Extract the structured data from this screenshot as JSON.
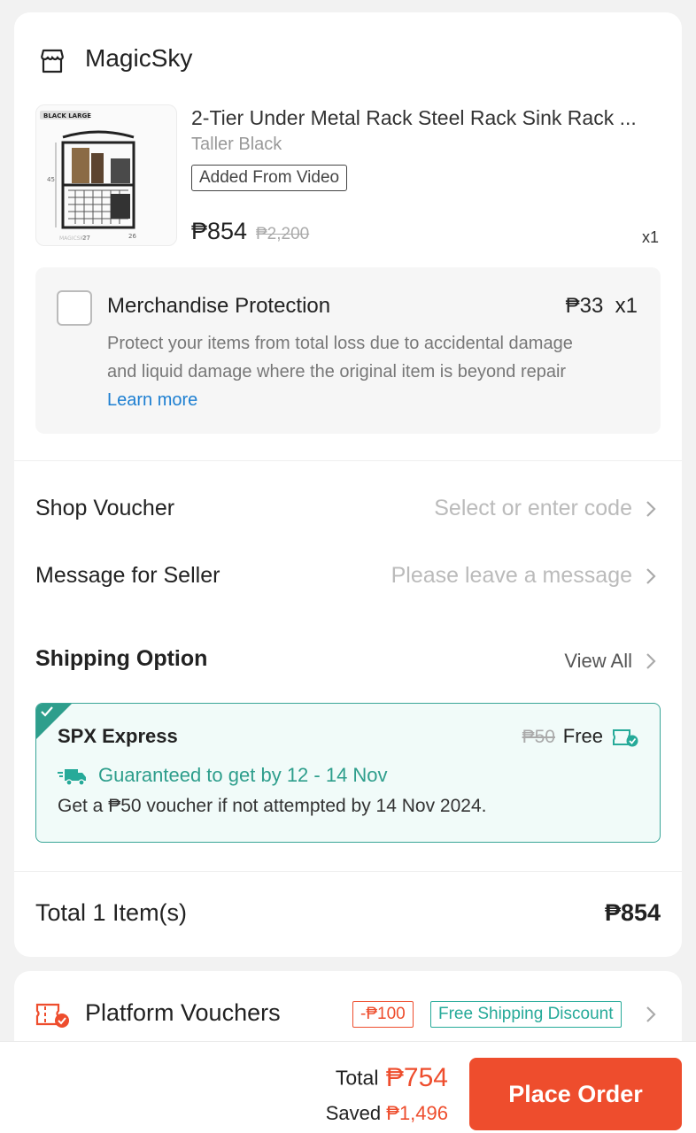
{
  "shop": {
    "name": "MagicSky"
  },
  "product": {
    "title": "2-Tier Under Metal Rack Steel Rack Sink Rack ...",
    "variant": "Taller Black",
    "badge": "Added From Video",
    "price": "₱854",
    "original_price": "₱2,200",
    "quantity": "x1",
    "image": {
      "tag": "BLACK LARGE",
      "dim_w": "27",
      "dim_d": "26",
      "dim_h": "45",
      "watermark": "MAGICSKY"
    }
  },
  "protection": {
    "title": "Merchandise Protection",
    "price": "₱33",
    "quantity": "x1",
    "description": "Protect your items from total loss due to accidental damage and liquid damage where the original item is beyond repair",
    "learn_more": "Learn more"
  },
  "shop_voucher": {
    "label": "Shop Voucher",
    "placeholder": "Select or enter code"
  },
  "message": {
    "label": "Message for Seller",
    "placeholder": "Please leave a message"
  },
  "shipping": {
    "title": "Shipping Option",
    "view_all": "View All",
    "carrier": "SPX Express",
    "original_fee": "₱50",
    "fee": "Free",
    "guarantee": "Guaranteed to get by 12 - 14 Nov",
    "note": "Get a ₱50 voucher if not attempted by 14 Nov 2024."
  },
  "order_total": {
    "label": "Total 1 Item(s)",
    "value": "₱854"
  },
  "platform_vouchers": {
    "label": "Platform Vouchers",
    "discount_badge": "-₱100",
    "shipping_badge": "Free Shipping Discount"
  },
  "checkout": {
    "total_label": "Total",
    "total_value": "₱754",
    "saved_label": "Saved",
    "saved_value": "₱1,496",
    "button": "Place Order"
  },
  "colors": {
    "accent": "#ee4d2d",
    "teal": "#26aa99",
    "link": "#1d7fd1"
  }
}
